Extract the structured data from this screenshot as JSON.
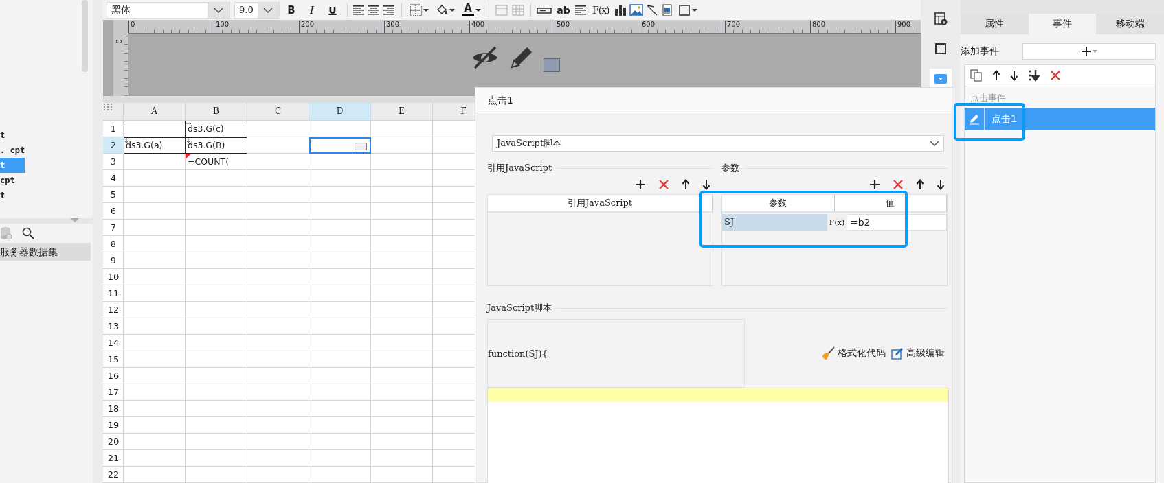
{
  "file_tree": {
    "items": [
      {
        "label": "t",
        "selected": false
      },
      {
        "label": ". cpt",
        "selected": false
      },
      {
        "label": "t",
        "selected": true
      },
      {
        "label": "cpt",
        "selected": false
      },
      {
        "label": "t",
        "selected": false
      }
    ],
    "dataset_label": "服务器数据集"
  },
  "toolbar": {
    "font": "黑体",
    "font_size": "9.0",
    "style_labels": [
      "B",
      "I",
      "U"
    ],
    "font_color_label": "A",
    "widget_labels": [
      "ab",
      "F(x)"
    ]
  },
  "ruler": {
    "top_labels": [
      "0",
      "100",
      "200",
      "300",
      "400",
      "500",
      "600",
      "700",
      "800",
      "900"
    ],
    "left_labels": [
      "0"
    ]
  },
  "sheet": {
    "columns": [
      {
        "label": "A",
        "selected": false
      },
      {
        "label": "B",
        "selected": false
      },
      {
        "label": "C",
        "selected": false
      },
      {
        "label": "D",
        "selected": true
      },
      {
        "label": "E",
        "selected": false
      },
      {
        "label": "F",
        "selected": false
      }
    ],
    "rows": [
      {
        "label": "1",
        "selected": false,
        "cells": [
          {
            "kind": "framed_blank"
          },
          {
            "kind": "framed_expand_right",
            "text": "ds3.G(c)"
          },
          {
            "kind": "blank"
          },
          {
            "kind": "blank"
          },
          {
            "kind": "blank"
          },
          {
            "kind": "blank"
          }
        ]
      },
      {
        "label": "2",
        "selected": true,
        "cells": [
          {
            "kind": "framed_expand_down",
            "text": "ds3.G(a)"
          },
          {
            "kind": "framed_expand_down",
            "text": "ds3.G(B)"
          },
          {
            "kind": "blank"
          },
          {
            "kind": "widget"
          },
          {
            "kind": "blank"
          },
          {
            "kind": "blank"
          }
        ]
      },
      {
        "label": "3",
        "selected": false,
        "cells": [
          {
            "kind": "blank"
          },
          {
            "kind": "formula",
            "text": "=COUNT("
          },
          {
            "kind": "blank"
          },
          {
            "kind": "blank"
          },
          {
            "kind": "blank"
          },
          {
            "kind": "blank"
          }
        ]
      },
      {
        "label": "4",
        "selected": false
      },
      {
        "label": "5",
        "selected": false
      },
      {
        "label": "6",
        "selected": false
      },
      {
        "label": "7",
        "selected": false
      },
      {
        "label": "8",
        "selected": false
      },
      {
        "label": "9",
        "selected": false
      },
      {
        "label": "10",
        "selected": false
      },
      {
        "label": "11",
        "selected": false
      },
      {
        "label": "12",
        "selected": false
      },
      {
        "label": "13",
        "selected": false
      },
      {
        "label": "14",
        "selected": false
      },
      {
        "label": "15",
        "selected": false
      },
      {
        "label": "16",
        "selected": false
      },
      {
        "label": "17",
        "selected": false
      },
      {
        "label": "18",
        "selected": false
      },
      {
        "label": "19",
        "selected": false
      },
      {
        "label": "20",
        "selected": false
      },
      {
        "label": "21",
        "selected": false
      },
      {
        "label": "22",
        "selected": false
      }
    ]
  },
  "dialog": {
    "title": "点击1",
    "script_type": "JavaScript脚本",
    "imports": {
      "title": "引用JavaScript",
      "column": "引用JavaScript"
    },
    "params": {
      "title": "参数",
      "columns": [
        "参数",
        "值"
      ],
      "rows": [
        {
          "name": "SJ",
          "formula_label": "F(x)",
          "value": "=b2",
          "selected": true
        }
      ]
    },
    "script": {
      "title": "JavaScript脚本",
      "signature": "function(SJ){"
    },
    "actions": [
      "格式化代码",
      "高级编辑"
    ]
  },
  "properties_panel": {
    "tabs": [
      {
        "label": "属性",
        "selected": false
      },
      {
        "label": "事件",
        "selected": true
      },
      {
        "label": "移动端",
        "selected": false
      }
    ],
    "add_event_label": "添加事件",
    "event_group": "点击事件",
    "events": [
      {
        "label": "点击1",
        "selected": true
      }
    ]
  }
}
